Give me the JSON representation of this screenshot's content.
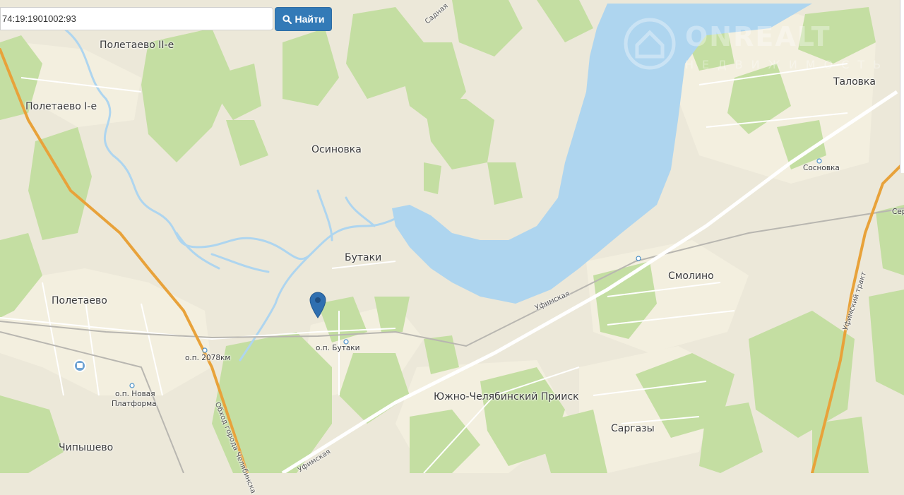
{
  "search": {
    "value": "74:19:1901002:93",
    "button_label": "Найти"
  },
  "watermark": {
    "brand": "ONREALT",
    "sub": "НЕДВИЖИМОСТЬ"
  },
  "places": {
    "poletaevo2": "Полетаево II-е",
    "poletaevo1": "Полетаево I-е",
    "osinovka": "Осиновка",
    "talovka": "Таловка",
    "sosnovka": "Сосновка",
    "butaki": "Бутаки",
    "smolino": "Смолино",
    "poletaevo": "Полетаево",
    "op_butaki": "о.п. Бутаки",
    "op_2078": "о.п. 2078км",
    "op_novaya": "о.п. Новая",
    "platforma": "Платформа",
    "yuzhno": "Южно-Челябинский Прииск",
    "sargazy": "Саргазы",
    "chipyshevo": "Чипышево",
    "ser": "Сер"
  },
  "roads": {
    "ufimskaya1": "Уфимская",
    "ufimskaya2": "Уфимская",
    "ufimsky_trakt": "Уфимский тракт",
    "obhod": "Обход города Челябинска",
    "sadovaya": "Садная"
  },
  "colors": {
    "land": "#ece8d9",
    "forest": "#c4dea2",
    "water": "#aed5ef",
    "road_main": "#e8a23a",
    "marker": "#2f6fb0"
  }
}
